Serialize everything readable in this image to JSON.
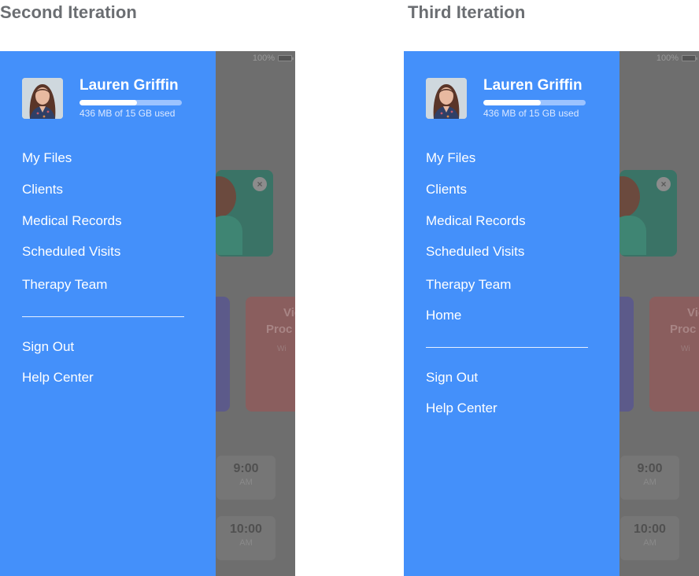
{
  "panels": [
    {
      "title": "Second Iteration",
      "status_battery": "100%",
      "user": {
        "name": "Lauren Griffin",
        "storage_text": "436 MB of 15 GB used",
        "storage_fraction": 0.56
      },
      "menu": [
        "My Files",
        "Clients",
        "Medical Records",
        "Scheduled Visits",
        "Therapy Team"
      ],
      "secondary_menu": [
        "Sign Out",
        "Help Center"
      ],
      "background": {
        "card_text": [
          "Vie",
          "Proc",
          "Wi"
        ],
        "times": [
          {
            "time": "9:00",
            "ampm": "AM"
          },
          {
            "time": "10:00",
            "ampm": "AM"
          }
        ]
      }
    },
    {
      "title": "Third Iteration",
      "status_battery": "100%",
      "user": {
        "name": "Lauren Griffin",
        "storage_text": "436 MB of 15 GB used",
        "storage_fraction": 0.56
      },
      "menu": [
        "My Files",
        "Clients",
        "Medical Records",
        "Scheduled Visits",
        "Therapy Team",
        "Home"
      ],
      "secondary_menu": [
        "Sign Out",
        "Help Center"
      ],
      "background": {
        "card_text": [
          "Vie",
          "Proc",
          "Wi"
        ],
        "times": [
          {
            "time": "9:00",
            "ampm": "AM"
          },
          {
            "time": "10:00",
            "ampm": "AM"
          }
        ]
      }
    }
  ],
  "colors": {
    "drawer": "#4490fa",
    "overlay": "#6e6e6e",
    "title": "#6b6e72"
  }
}
